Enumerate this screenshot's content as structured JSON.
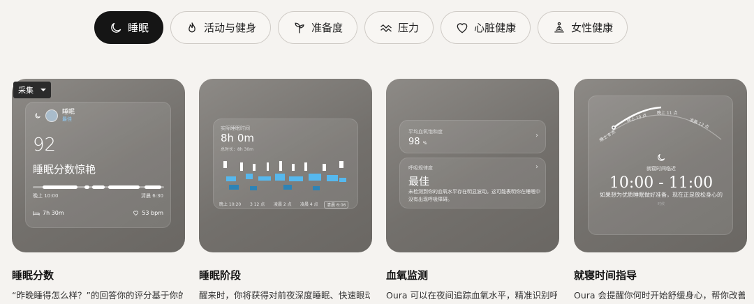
{
  "tabs": [
    {
      "label": "睡眠",
      "icon": "moon-icon",
      "active": true
    },
    {
      "label": "活动与健身",
      "icon": "flame-icon",
      "active": false
    },
    {
      "label": "准备度",
      "icon": "sprout-icon",
      "active": false
    },
    {
      "label": "压力",
      "icon": "waves-icon",
      "active": false
    },
    {
      "label": "心脏健康",
      "icon": "heart-icon",
      "active": false
    },
    {
      "label": "女性健康",
      "icon": "lotus-icon",
      "active": false
    }
  ],
  "dropdown": {
    "label": "采集"
  },
  "sleep_score_card": {
    "title": "睡眠",
    "subtitle": "最佳",
    "score": "92",
    "score_label": "睡眠分数惊艳",
    "start_time": "晚上 10:00",
    "end_time": "清晨 6:30",
    "duration": "7h 30m",
    "heart_rate": "53 bpm"
  },
  "sleep_stages_card": {
    "label": "实际睡眠时间",
    "value": "8h 0m",
    "total": "总时长：8h 30m",
    "axis": [
      "晚上 10:20",
      "3 12 点",
      "凌晨 2 点",
      "凌晨 4 点",
      "清晨 6:06"
    ]
  },
  "oxygen_card": {
    "avg_label": "平均血氧饱和度",
    "avg_value": "98",
    "avg_unit": "%",
    "breath_label": "呼吸规律度",
    "breath_value": "最佳",
    "breath_desc": "未检测到你的血氧水平存在明显波动。这可能表明你在睡眠中没有出现呼吸障碍。"
  },
  "bedtime_card": {
    "arc_labels": [
      "晚上 8 点",
      "晚上 10 点",
      "晚上 11 点",
      "凌晨 12 点"
    ],
    "title": "就寝时间临近",
    "window": "10:00 - 11:00",
    "desc": "如果想为优质睡眠做好准备，现在正是放松身心的",
    "footnote": "时候"
  },
  "features": [
    {
      "title": "睡眠分数",
      "desc": "“昨晚睡得怎么样？”的回答你的评分基于你的总"
    },
    {
      "title": "睡眠阶段",
      "desc": "醒来时，你将获得对前夜深度睡眠、快速眼动睡"
    },
    {
      "title": "血氧监测",
      "desc": "Oura 可以在夜间追踪血氧水平，精准识别呼吸"
    },
    {
      "title": "就寝时间指导",
      "desc": "Oura 会提醒你何时开始舒缓身心，帮你改善睡"
    }
  ],
  "colors": {
    "accent_blue": "#4fb0e6",
    "dark": "#151515"
  }
}
